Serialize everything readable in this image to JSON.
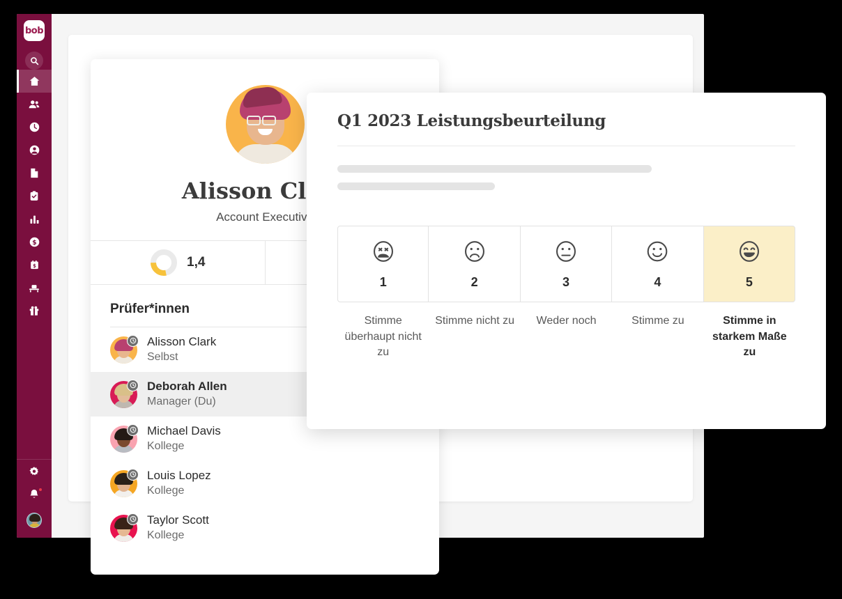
{
  "colors": {
    "sidebar": "#7A0F3E",
    "accent_yellow": "#F7C23B",
    "selected_cell_bg": "#FBEFC8",
    "app_bg": "#F5F5F5"
  },
  "sidebar": {
    "logo_text": "bob",
    "search_icon": "search-icon",
    "items": [
      {
        "icon": "home-icon",
        "active": true
      },
      {
        "icon": "people-icon",
        "active": false
      },
      {
        "icon": "clock-icon",
        "active": false
      },
      {
        "icon": "person-circle-icon",
        "active": false
      },
      {
        "icon": "document-icon",
        "active": false
      },
      {
        "icon": "clipboard-check-icon",
        "active": false
      },
      {
        "icon": "bar-chart-icon",
        "active": false
      },
      {
        "icon": "dollar-circle-icon",
        "active": false
      },
      {
        "icon": "payroll-calendar-icon",
        "active": false
      },
      {
        "icon": "desk-icon",
        "active": false
      },
      {
        "icon": "gift-icon",
        "active": false
      }
    ],
    "bottom_items": [
      {
        "icon": "gear-icon"
      },
      {
        "icon": "bell-icon",
        "has_dot": true
      }
    ],
    "user_avatar": "user-avatar"
  },
  "profile": {
    "avatar": "alisson-clark-avatar",
    "name": "Alisson Clark",
    "role": "Account Executive",
    "stats": [
      {
        "icon": "donut-chart-icon",
        "value": "1,4",
        "percent": 28
      },
      {
        "icon": "target-icon",
        "value": ""
      }
    ],
    "reviewers_title": "Prüfer*innen",
    "reviewers": [
      {
        "name": "Alisson Clark",
        "role": "Selbst",
        "ring_color": "#F9B44A",
        "hair": "#B8416F",
        "skin": "#E8B68E",
        "torso": "#EFE9DF",
        "badge": "clock-icon",
        "selected": false
      },
      {
        "name": "Deborah Allen",
        "role": "Manager (Du)",
        "ring_color": "#D81B56",
        "hair": "#D9C089",
        "skin": "#E2BC9A",
        "torso": "#BFB8B0",
        "badge": "clock-icon",
        "selected": true
      },
      {
        "name": "Michael Davis",
        "role": "Kollege",
        "ring_color": "#F9A3B0",
        "hair": "#241A15",
        "skin": "#7B4A2E",
        "torso": "#B9BCC2",
        "badge": "clock-icon",
        "selected": false
      },
      {
        "name": "Louis Lopez",
        "role": "Kollege",
        "ring_color": "#F5A623",
        "hair": "#2A2018",
        "skin": "#E0B391",
        "torso": "#F2F0ED",
        "badge": "clock-icon",
        "selected": false
      },
      {
        "name": "Taylor Scott",
        "role": "Kollege",
        "ring_color": "#E8134F",
        "hair": "#3A2217",
        "skin": "#E5B892",
        "torso": "#F0ECE8",
        "badge": "clock-icon",
        "selected": false
      }
    ]
  },
  "review_modal": {
    "title": "Q1 2023 Leistungsbeurteilung",
    "skeleton_lines": 2,
    "scale": {
      "options": [
        {
          "value": "1",
          "label": "Stimme überhaupt nicht zu",
          "face": "face-very-sad",
          "selected": false
        },
        {
          "value": "2",
          "label": "Stimme nicht zu",
          "face": "face-sad",
          "selected": false
        },
        {
          "value": "3",
          "label": "Weder noch",
          "face": "face-neutral",
          "selected": false
        },
        {
          "value": "4",
          "label": "Stimme zu",
          "face": "face-happy",
          "selected": false
        },
        {
          "value": "5",
          "label": "Stimme in starkem Maße zu",
          "face": "face-very-happy",
          "selected": true
        }
      ]
    }
  }
}
